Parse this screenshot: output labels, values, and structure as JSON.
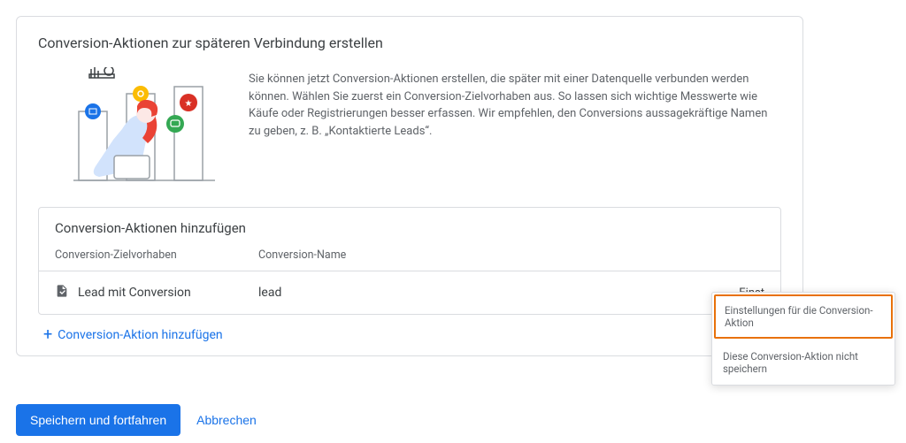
{
  "card": {
    "title": "Conversion-Aktionen zur späteren Verbindung erstellen",
    "description": "Sie können jetzt Conversion-Aktionen erstellen, die später mit einer Datenquelle verbunden werden können. Wählen Sie zuerst ein Conversion-Zielvorhaben aus. So lassen sich wichtige Messwerte wie Käufe oder Registrierungen besser erfassen. Wir empfehlen, den Conversions aussagekräftige Namen zu geben, z. B. „Kontaktierte Leads“."
  },
  "table": {
    "title": "Conversion-Aktionen hinzufügen",
    "headers": {
      "goal": "Conversion-Zielvorhaben",
      "name": "Conversion-Name"
    },
    "row": {
      "goal": "Lead mit Conversion",
      "name": "lead",
      "settings_label": "Einst"
    }
  },
  "add_link": "Conversion-Aktion hinzufügen",
  "footer": {
    "save": "Speichern und fortfahren",
    "cancel": "Abbrechen"
  },
  "popover": {
    "item1": "Einstellungen für die Conversion-Aktion",
    "item2": "Diese Conversion-Aktion nicht speichern"
  }
}
